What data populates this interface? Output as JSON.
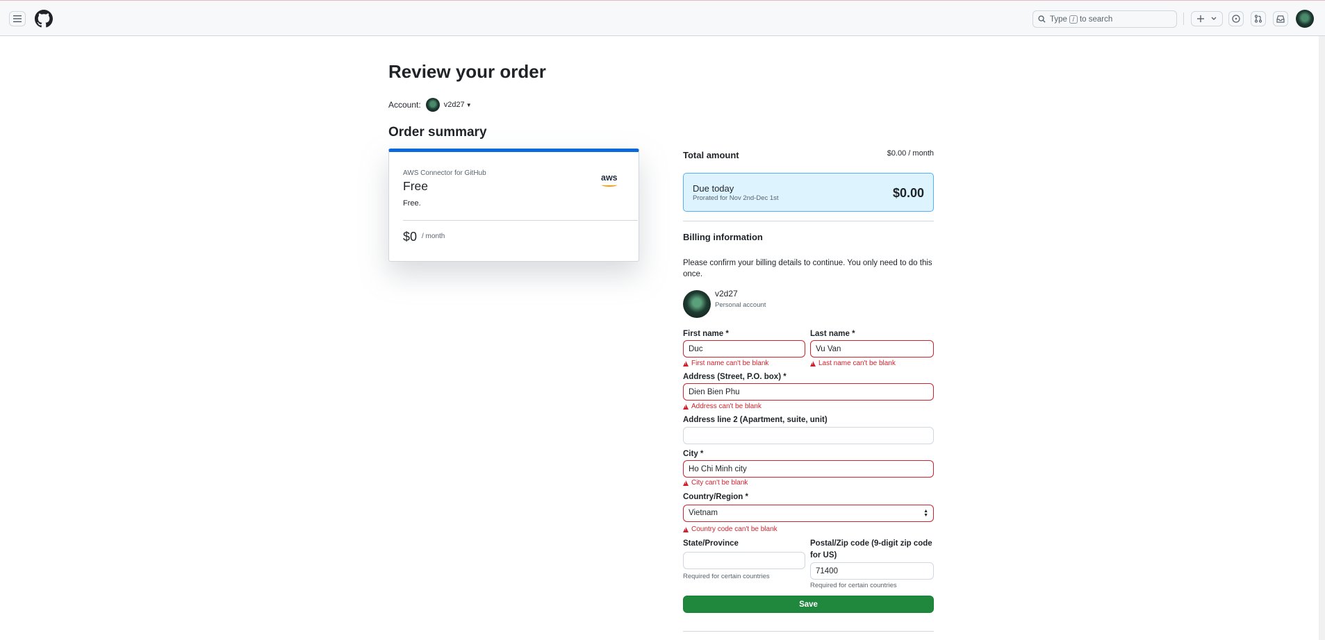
{
  "header": {
    "search_placeholder_prefix": "Type",
    "search_key": "/",
    "search_placeholder_suffix": "to search",
    "icons": [
      "hamburger-menu-icon",
      "github-logo-icon",
      "search-icon",
      "plus-icon",
      "issues-icon",
      "pull-requests-icon",
      "inbox-icon"
    ]
  },
  "page": {
    "title": "Review your order",
    "account_label": "Account:",
    "account_name": "v2d27",
    "summary_title": "Order summary"
  },
  "plan": {
    "product": "AWS Connector for GitHub",
    "name": "Free",
    "description": "Free.",
    "logo_text": "aws",
    "price": "$0",
    "period": "/ month"
  },
  "totals": {
    "total_label": "Total amount",
    "total_value": "$0.00 / month",
    "due_label": "Due today",
    "due_sub": "Prorated for Nov 2nd-Dec 1st",
    "due_amount": "$0.00"
  },
  "billing": {
    "title": "Billing information",
    "description": "Please confirm your billing details to continue. You only need to do this once.",
    "user_name": "v2d27",
    "user_type": "Personal account",
    "first_name_label": "First name *",
    "first_name_value": "Duc",
    "first_name_error": "First name can't be blank",
    "last_name_label": "Last name *",
    "last_name_value": "Vu Van",
    "last_name_error": "Last name can't be blank",
    "address_label": "Address (Street, P.O. box) *",
    "address_value": "Dien Bien Phu",
    "address_error": "Address can't be blank",
    "address2_label": "Address line 2 (Apartment, suite, unit)",
    "address2_value": "",
    "city_label": "City *",
    "city_value": "Ho Chi Minh city",
    "city_error": "City can't be blank",
    "country_label": "Country/Region *",
    "country_value": "Vietnam",
    "country_error": "Country code can't be blank",
    "state_label": "State/Province",
    "state_value": "",
    "state_hint": "Required for certain countries",
    "postal_label_line1": "Postal/Zip code (9-digit zip code",
    "postal_label_line2": "for US)",
    "postal_value": "71400",
    "postal_hint": "Required for certain countries",
    "save_label": "Save"
  },
  "colors": {
    "accent_blue": "#0969da",
    "error_red": "#cf222e",
    "save_green": "#1f883d",
    "due_bg": "#ddf4ff"
  }
}
